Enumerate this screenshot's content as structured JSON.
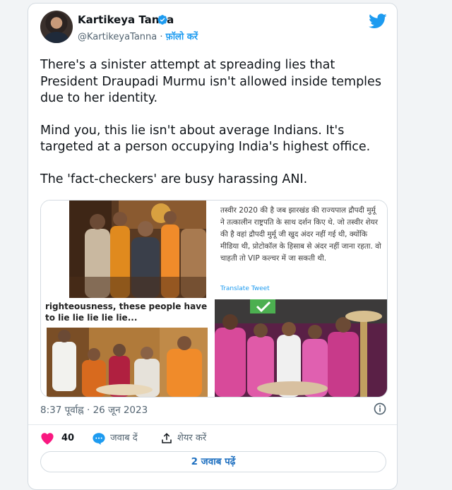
{
  "author": {
    "name": "Kartikeya Tanna",
    "handle": "@KartikeyaTanna",
    "separator": "·",
    "follow_label": "फ़ॉलो करें"
  },
  "tweet": {
    "paragraphs": [
      "There's a sinister attempt at spreading lies that President Draupadi Murmu isn't allowed inside temples due to her identity.",
      "Mind you, this lie isn't about average Indians. It's targeted at a person occupying India's highest office.",
      "The 'fact-checkers' are busy harassing ANI."
    ]
  },
  "media": {
    "hindi_caption": "तस्वीर 2020 की है जब झारखंड की राज्यपाल द्रौपदी मुर्मू ने तत्कालीन राष्ट्रपति के साथ दर्शन किए थे. जो तस्वीर शेयर की है वहां द्रौपदी मुर्मू जी खुद अंदर नहीं गई थी, क्योंकि मीडिया थी, प्रोटोकॉल के हिसाब से अंदर नहीं जाना रहता. वो चाहती तो VIP कल्चर में जा सकती थी.",
    "translate_label": "Translate Tweet",
    "english_caption": "righteousness, these people have to lie lie lie lie lie..."
  },
  "meta": {
    "time": "8:37 पूर्वाह्न",
    "separator": "·",
    "date": "26 जून 2023"
  },
  "actions": {
    "like_count": "40",
    "reply_label": "जवाब दें",
    "share_label": "शेयर करें"
  },
  "read_replies_label": "2 जवाब पढ़ें",
  "colors": {
    "accent": "#1d9bf0",
    "like": "#f91880",
    "text": "#0f1419",
    "muted": "#536471"
  }
}
